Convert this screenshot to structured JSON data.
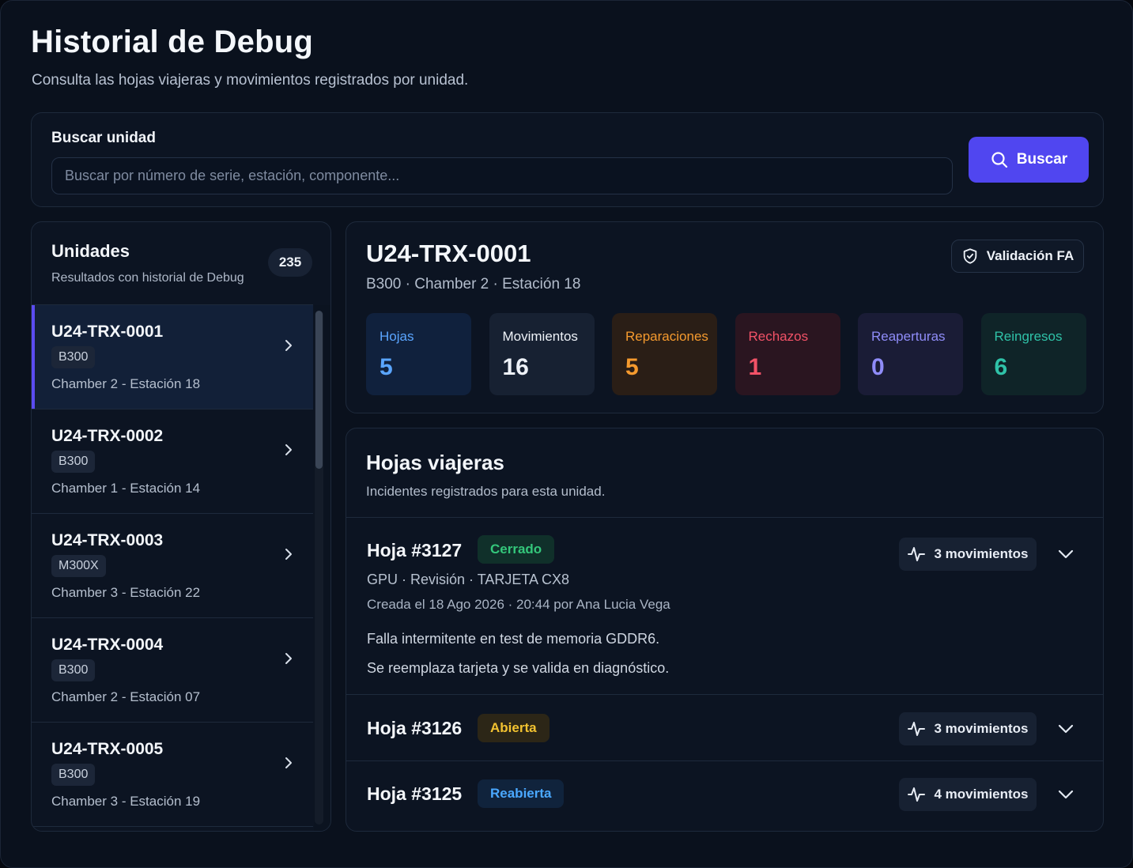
{
  "header": {
    "title": "Historial de Debug",
    "subtitle": "Consulta las hojas viajeras y movimientos registrados por unidad."
  },
  "search": {
    "label": "Buscar unidad",
    "placeholder": "Buscar por número de serie, estación, componente...",
    "value": "",
    "button_label": "Buscar",
    "button_icon": "search-icon"
  },
  "units": {
    "title": "Unidades",
    "subtitle": "Resultados con historial de Debug",
    "count": "235",
    "items": [
      {
        "name": "U24-TRX-0001",
        "model": "B300",
        "location": "Chamber 2 - Estación 18",
        "selected": true
      },
      {
        "name": "U24-TRX-0002",
        "model": "B300",
        "location": "Chamber 1 - Estación 14",
        "selected": false
      },
      {
        "name": "U24-TRX-0003",
        "model": "M300X",
        "location": "Chamber 3 - Estación 22",
        "selected": false
      },
      {
        "name": "U24-TRX-0004",
        "model": "B300",
        "location": "Chamber 2 - Estación 07",
        "selected": false
      },
      {
        "name": "U24-TRX-0005",
        "model": "B300",
        "location": "Chamber 3 - Estación 19",
        "selected": false
      }
    ]
  },
  "detail": {
    "title": "U24-TRX-0001",
    "meta": "B300 · Chamber 2 · Estación 18",
    "fa_button_label": "Validación FA",
    "fa_button_icon": "shield-check-icon",
    "stats": [
      {
        "label": "Hojas",
        "value": "5",
        "color": "#5aa5ff",
        "bg": "#10213d"
      },
      {
        "label": "Movimientos",
        "value": "16",
        "color": "#eef2f8",
        "bg": "#172132"
      },
      {
        "label": "Reparaciones",
        "value": "5",
        "color": "#f59a2e",
        "bg": "#2a1e16"
      },
      {
        "label": "Rechazos",
        "value": "1",
        "color": "#f25267",
        "bg": "#2a1520"
      },
      {
        "label": "Reaperturas",
        "value": "0",
        "color": "#8f8cf8",
        "bg": "#1a1c36"
      },
      {
        "label": "Reingresos",
        "value": "6",
        "color": "#2fc2a8",
        "bg": "#0f2428"
      }
    ]
  },
  "sheets": {
    "title": "Hojas viajeras",
    "subtitle": "Incidentes registrados para esta unidad.",
    "items": [
      {
        "title": "Hoja #3127",
        "status": "Cerrado",
        "status_color": "#34c77b",
        "status_bg": "#10302a",
        "movements": "3 movimientos",
        "expanded": true,
        "meta": "GPU · Revisión · TARJETA CX8",
        "created": "Creada el 18 Ago 2026 · 20:44 por Ana Lucia Vega",
        "description": "Falla intermitente en test de memoria GDDR6.",
        "resolution": "Se reemplaza tarjeta y se valida en diagnóstico."
      },
      {
        "title": "Hoja #3126",
        "status": "Abierta",
        "status_color": "#f2c230",
        "status_bg": "#2c2617",
        "movements": "3 movimientos",
        "expanded": false
      },
      {
        "title": "Hoja #3125",
        "status": "Reabierta",
        "status_color": "#4aa8ff",
        "status_bg": "#10233c",
        "movements": "4 movimientos",
        "expanded": false
      }
    ],
    "movement_icon": "activity-icon",
    "expand_icon": "chevron-down-icon"
  },
  "colors": {
    "accent": "#5046f0",
    "background": "#0a111d",
    "card": "#0c1422"
  }
}
